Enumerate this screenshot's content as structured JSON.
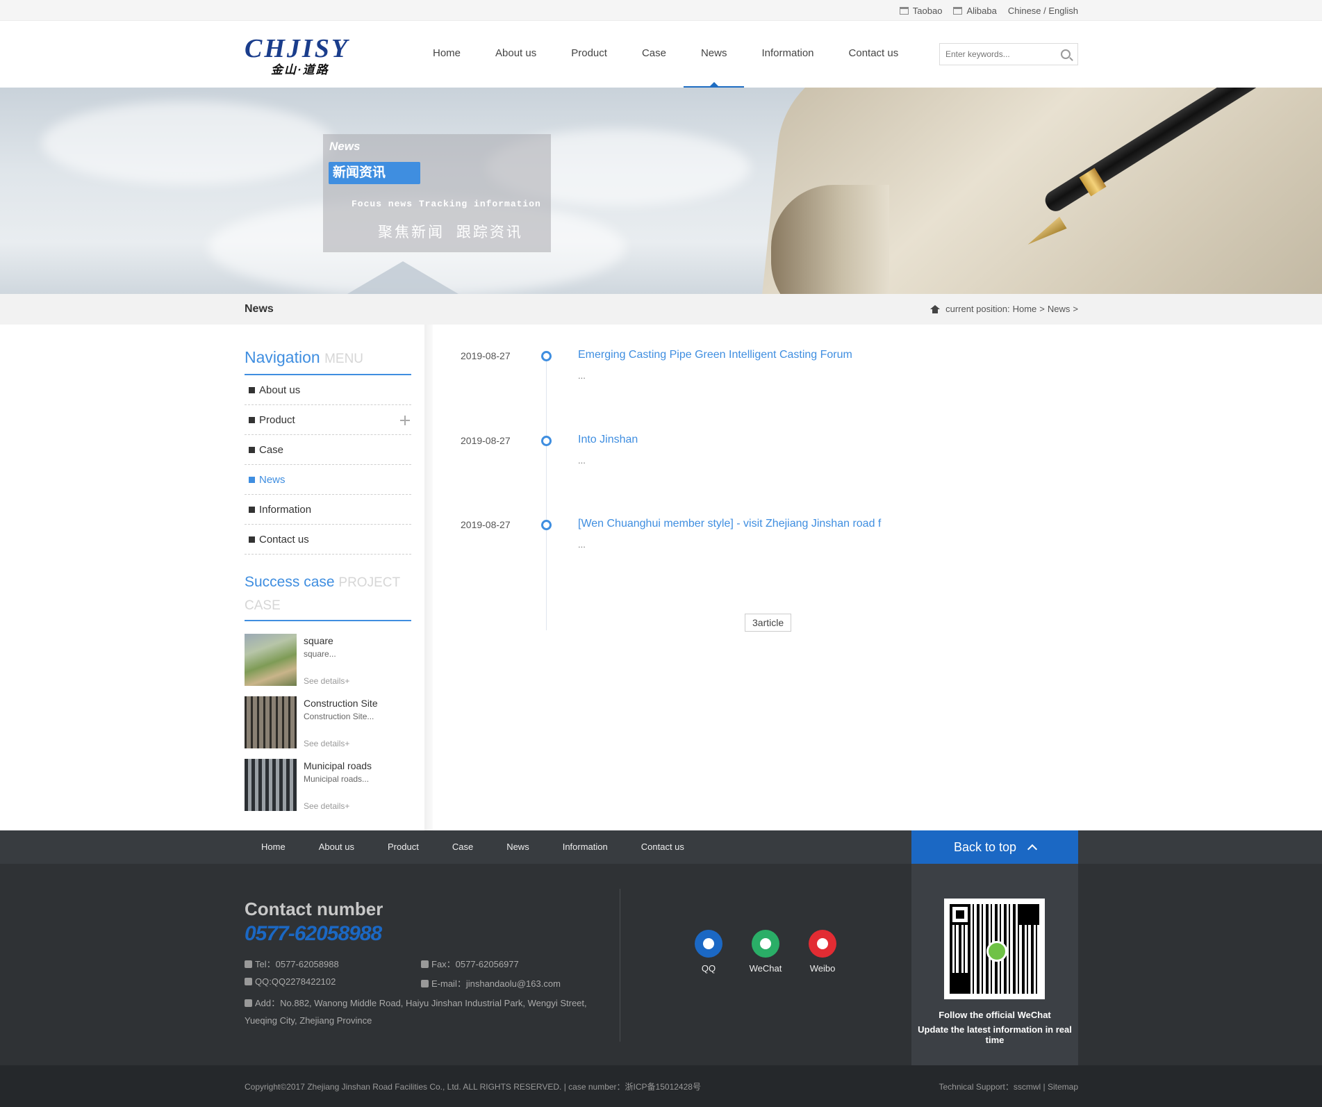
{
  "topbar": {
    "links": [
      "Taobao",
      "Alibaba"
    ],
    "language": "Chinese / English"
  },
  "brand": {
    "logo_en": "CHJISY",
    "logo_cn": "金山·道路"
  },
  "nav": {
    "items": [
      "Home",
      "About us",
      "Product",
      "Case",
      "News",
      "Information",
      "Contact us"
    ],
    "active": "News"
  },
  "search": {
    "placeholder": "Enter keywords..."
  },
  "banner": {
    "label_en": "News",
    "label_cn": "新闻资讯",
    "slogan_en": "Focus news Tracking information",
    "slogan_cn": "聚焦新闻 跟踪资讯"
  },
  "position_bar": {
    "title": "News",
    "prefix": "current position:",
    "crumbs": [
      "Home",
      ">",
      "News",
      ">"
    ]
  },
  "sidebar": {
    "nav_title": "Navigation",
    "nav_title_muted": "MENU",
    "menu": [
      "About us",
      "Product",
      "Case",
      "News",
      "Information",
      "Contact us"
    ],
    "active": "News",
    "case_title": "Success case",
    "case_title_muted": "PROJECT CASE",
    "cases": [
      {
        "name": "square",
        "desc": "square...",
        "more": "See details+"
      },
      {
        "name": "Construction Site",
        "desc": "Construction Site...",
        "more": "See details+"
      },
      {
        "name": "Municipal roads",
        "desc": "Municipal roads...",
        "more": "See details+"
      }
    ]
  },
  "news": {
    "items": [
      {
        "date": "2019-08-27",
        "title": "Emerging Casting Pipe Green Intelligent Casting Forum",
        "excerpt": "..."
      },
      {
        "date": "2019-08-27",
        "title": "Into Jinshan",
        "excerpt": "..."
      },
      {
        "date": "2019-08-27",
        "title": "[Wen Chuanghui member style] - visit Zhejiang Jinshan road f",
        "excerpt": "..."
      }
    ],
    "pager": "3article"
  },
  "footer_nav": {
    "items": [
      "Home",
      "About us",
      "Product",
      "Case",
      "News",
      "Information",
      "Contact us"
    ],
    "back_to_top": "Back to top"
  },
  "footer": {
    "contact_title": "Contact number",
    "phone": "0577-62058988",
    "tel": "Tel：0577-62058988",
    "fax": "Fax：0577-62056977",
    "qq": "QQ:QQ2278422102",
    "email": "E-mail：jinshandaolu@163.com",
    "address_1": "Add：No.882, Wanong Middle Road, Haiyu Jinshan Industrial Park, Wengyi Street,",
    "address_2": "Yueqing City, Zhejiang Province",
    "social": [
      "QQ",
      "WeChat",
      "Weibo"
    ],
    "qr_line_1": "Follow the official WeChat",
    "qr_line_2": "Update the latest information in real time"
  },
  "copyright": {
    "left": "Copyright©2017 Zhejiang Jinshan Road Facilities Co., Ltd. ALL RIGHTS RESERVED.  |  case number：浙ICP备15012428号",
    "right": "Technical Support：sscmwl  |  Sitemap"
  },
  "colors": {
    "accent": "#3f8ee0",
    "brand_blue": "#1b68c4",
    "footer_bg": "#2f3235"
  }
}
